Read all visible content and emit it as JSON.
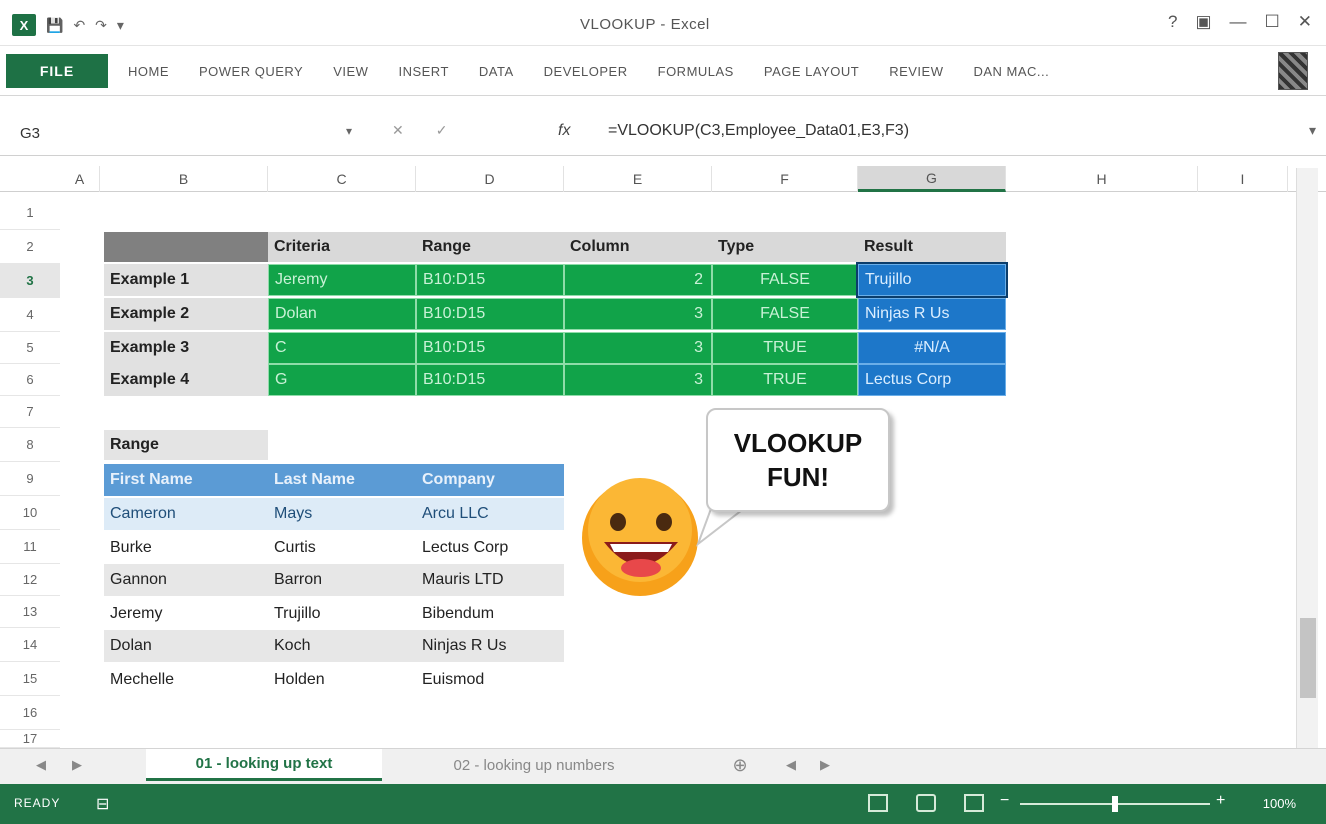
{
  "app": {
    "title": "VLOOKUP - Excel",
    "icon": "excel-icon",
    "accent": "#217346"
  },
  "window_controls": [
    "?",
    "▣",
    "—",
    "☐",
    "✕"
  ],
  "qat": {
    "undo": "↶",
    "redo": "↷",
    "save": "💾",
    "more": "▾"
  },
  "ribbon": {
    "file": "FILE",
    "tabs": [
      "HOME",
      "POWER QUERY",
      "VIEW",
      "INSERT",
      "DATA",
      "DEVELOPER",
      "FORMULAS",
      "PAGE LAYOUT",
      "REVIEW",
      "DAN MAC..."
    ]
  },
  "formula_bar": {
    "name_box": "G3",
    "cancel": "✕",
    "enter": "✓",
    "fx": "fx",
    "formula": "=VLOOKUP(C3,Employee_Data01,E3,F3)"
  },
  "columns": [
    "A",
    "B",
    "C",
    "D",
    "E",
    "F",
    "G",
    "H",
    "I"
  ],
  "rows": [
    "1",
    "2",
    "3",
    "4",
    "5",
    "6",
    "7",
    "8",
    "9",
    "10",
    "11",
    "12",
    "13",
    "14",
    "15",
    "16",
    "17"
  ],
  "table1": {
    "headers": [
      "Criteria",
      "Range",
      "Column",
      "Type",
      "Result"
    ],
    "rows": [
      {
        "label": "Example 1",
        "criteria": "Jeremy",
        "range": "B10:D15",
        "column": "2",
        "type": "FALSE",
        "result": "Trujillo"
      },
      {
        "label": "Example 2",
        "criteria": "Dolan",
        "range": "B10:D15",
        "column": "3",
        "type": "FALSE",
        "result": "Ninjas R Us"
      },
      {
        "label": "Example 3",
        "criteria": "C",
        "range": "B10:D15",
        "column": "3",
        "type": "TRUE",
        "result": "#N/A"
      },
      {
        "label": "Example 4",
        "criteria": "G",
        "range": "B10:D15",
        "column": "3",
        "type": "TRUE",
        "result": "Lectus Corp"
      }
    ]
  },
  "table2": {
    "label": "Range",
    "headers": [
      "First Name",
      "Last Name",
      "Company"
    ],
    "rows": [
      [
        "Cameron",
        "Mays",
        "Arcu LLC"
      ],
      [
        "Burke",
        "Curtis",
        "Lectus Corp"
      ],
      [
        "Gannon",
        "Barron",
        "Mauris LTD"
      ],
      [
        "Jeremy",
        "Trujillo",
        "Bibendum"
      ],
      [
        "Dolan",
        "Koch",
        "Ninjas R Us"
      ],
      [
        "Mechelle",
        "Holden",
        "Euismod"
      ]
    ]
  },
  "callout": {
    "line1": "VLOOKUP",
    "line2": "FUN!"
  },
  "sheets": {
    "active": "01 - looking up text",
    "inactive": "02 - looking up numbers",
    "add": "⊕"
  },
  "status": {
    "ready": "READY",
    "zoom": "100%"
  }
}
